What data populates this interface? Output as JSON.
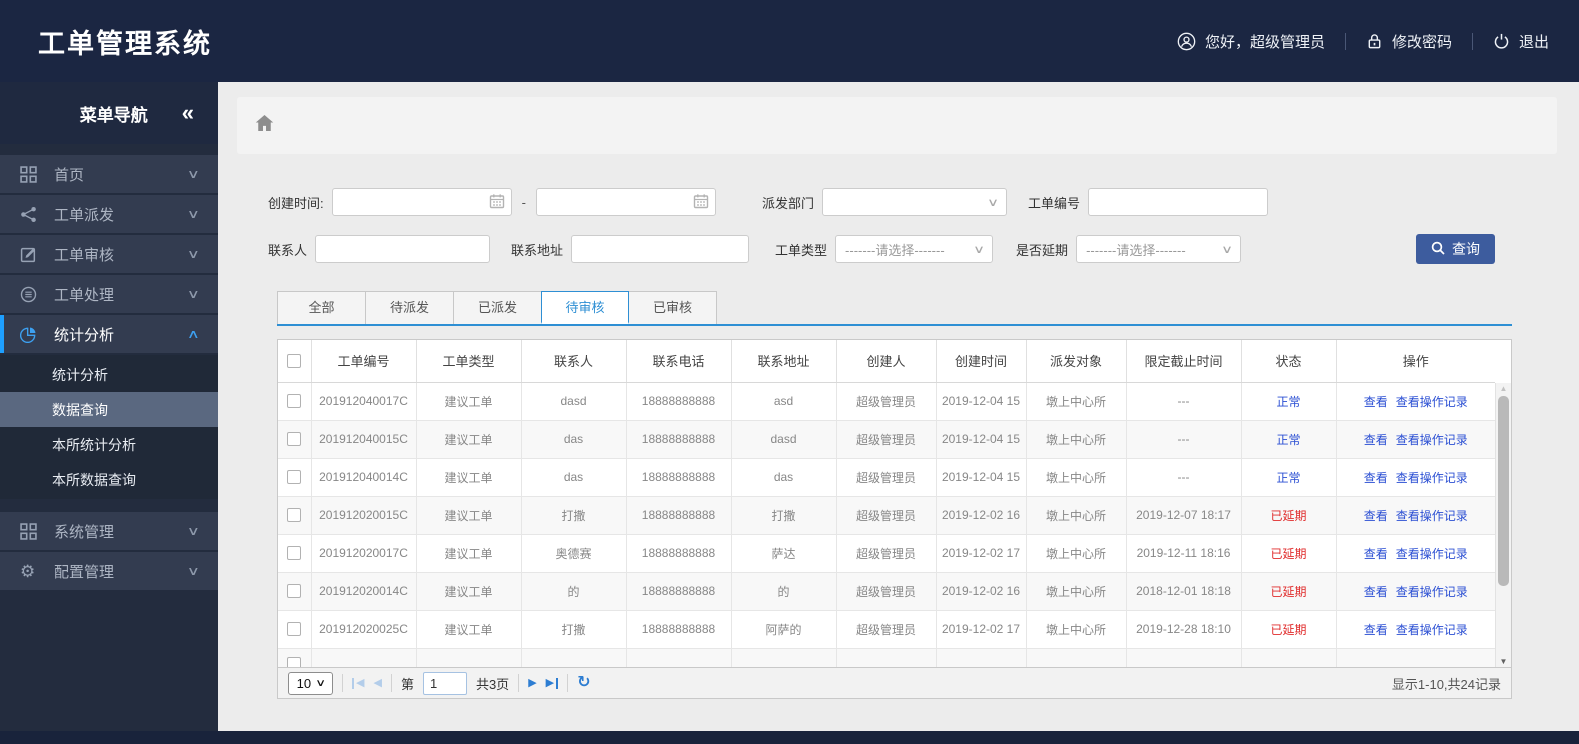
{
  "header": {
    "title": "工单管理系统",
    "greeting": "您好，超级管理员",
    "change_password": "修改密码",
    "logout": "退出"
  },
  "sidebar": {
    "nav_title": "菜单导航",
    "collapse": "«",
    "items": [
      {
        "label": "首页",
        "icon": "grid-icon"
      },
      {
        "label": "工单派发",
        "icon": "share-icon"
      },
      {
        "label": "工单审核",
        "icon": "edit-icon"
      },
      {
        "label": "工单处理",
        "icon": "process-icon"
      },
      {
        "label": "统计分析",
        "icon": "pie-icon",
        "active": true,
        "children": [
          {
            "label": "统计分析"
          },
          {
            "label": "数据查询",
            "selected": true
          },
          {
            "label": "本所统计分析"
          },
          {
            "label": "本所数据查询"
          }
        ]
      },
      {
        "label": "系统管理",
        "icon": "grid-icon",
        "gap_before": true
      },
      {
        "label": "配置管理",
        "icon": "gear-icon"
      }
    ]
  },
  "filters": {
    "created_time_label": "创建时间:",
    "date_separator": "-",
    "dispatch_dept_label": "派发部门",
    "order_no_label": "工单编号",
    "contact_label": "联系人",
    "address_label": "联系地址",
    "order_type_label": "工单类型",
    "delay_label": "是否延期",
    "select_placeholder": "-------请选择-------",
    "search_button": "查询"
  },
  "tabs": [
    {
      "label": "全部"
    },
    {
      "label": "待派发"
    },
    {
      "label": "已派发"
    },
    {
      "label": "待审核",
      "active": true
    },
    {
      "label": "已审核"
    }
  ],
  "table": {
    "columns": [
      "工单编号",
      "工单类型",
      "联系人",
      "联系电话",
      "联系地址",
      "创建人",
      "创建时间",
      "派发对象",
      "限定截止时间",
      "状态",
      "操作"
    ],
    "action_labels": [
      "查看",
      "查看操作记录"
    ],
    "rows": [
      {
        "id": "201912040017C",
        "type": "建议工单",
        "contact": "dasd",
        "phone": "18888888888",
        "address": "asd",
        "creator": "超级管理员",
        "created": "2019-12-04 15",
        "target": "墩上中心所",
        "deadline": "---",
        "status": "正常",
        "status_type": "normal"
      },
      {
        "id": "201912040015C",
        "type": "建议工单",
        "contact": "das",
        "phone": "18888888888",
        "address": "dasd",
        "creator": "超级管理员",
        "created": "2019-12-04 15",
        "target": "墩上中心所",
        "deadline": "---",
        "status": "正常",
        "status_type": "normal"
      },
      {
        "id": "201912040014C",
        "type": "建议工单",
        "contact": "das",
        "phone": "18888888888",
        "address": "das",
        "creator": "超级管理员",
        "created": "2019-12-04 15",
        "target": "墩上中心所",
        "deadline": "---",
        "status": "正常",
        "status_type": "normal"
      },
      {
        "id": "201912020015C",
        "type": "建议工单",
        "contact": "打撒",
        "phone": "18888888888",
        "address": "打撒",
        "creator": "超级管理员",
        "created": "2019-12-02 16",
        "target": "墩上中心所",
        "deadline": "2019-12-07 18:17",
        "status": "已延期",
        "status_type": "delayed"
      },
      {
        "id": "201912020017C",
        "type": "建议工单",
        "contact": "奥德赛",
        "phone": "18888888888",
        "address": "萨达",
        "creator": "超级管理员",
        "created": "2019-12-02 17",
        "target": "墩上中心所",
        "deadline": "2019-12-11 18:16",
        "status": "已延期",
        "status_type": "delayed"
      },
      {
        "id": "201912020014C",
        "type": "建议工单",
        "contact": "的",
        "phone": "18888888888",
        "address": "的",
        "creator": "超级管理员",
        "created": "2019-12-02 16",
        "target": "墩上中心所",
        "deadline": "2018-12-01 18:18",
        "status": "已延期",
        "status_type": "delayed"
      },
      {
        "id": "201912020025C",
        "type": "建议工单",
        "contact": "打撒",
        "phone": "18888888888",
        "address": "阿萨的",
        "creator": "超级管理员",
        "created": "2019-12-02 17",
        "target": "墩上中心所",
        "deadline": "2019-12-28 18:10",
        "status": "已延期",
        "status_type": "delayed"
      }
    ]
  },
  "pagination": {
    "page_size": "10",
    "page_label_prefix": "第",
    "page_value": "1",
    "total_pages_label": "共3页",
    "summary": "显示1-10,共24记录"
  },
  "icons": {
    "chevron_down": "∨",
    "chevron_up": "∧",
    "select_caret": "∨",
    "prev": "◀",
    "next": "▶",
    "scroll_up": "▲",
    "scroll_down": "▼",
    "refresh": "↻"
  },
  "colors": {
    "accent": "#2e8fd4",
    "link_blue": "#2b4fd3",
    "danger_red": "#e02b2b",
    "button_blue": "#3d5c9e",
    "active_bar": "#1e9fff",
    "pager_blue": "#2d7dd2"
  }
}
